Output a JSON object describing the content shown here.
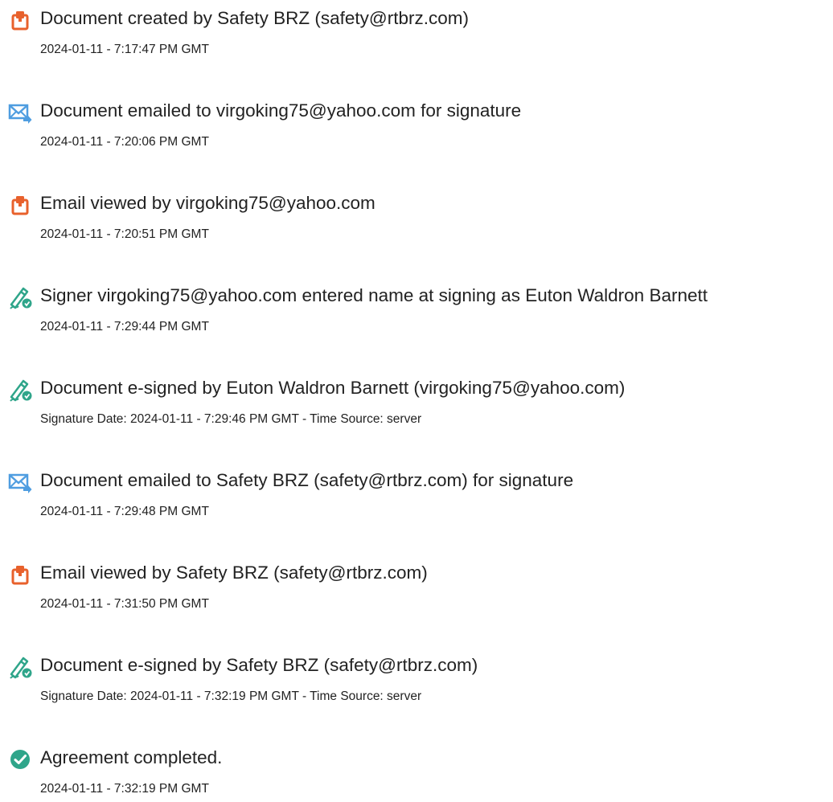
{
  "colors": {
    "document_icon": "#e8612c",
    "email_icon": "#4f9de0",
    "sign_icon": "#2fa58a",
    "complete_icon": "#2fa58a",
    "text": "#222222"
  },
  "events": [
    {
      "icon": "document-icon",
      "title": "Document created by Safety BRZ (safety@rtbrz.com)",
      "detail": "2024-01-11 - 7:17:47 PM GMT"
    },
    {
      "icon": "email-icon",
      "title": "Document emailed to virgoking75@yahoo.com for signature",
      "detail": "2024-01-11 - 7:20:06 PM GMT"
    },
    {
      "icon": "document-icon",
      "title": "Email viewed by virgoking75@yahoo.com",
      "detail": "2024-01-11 - 7:20:51 PM GMT"
    },
    {
      "icon": "signature-icon",
      "title": "Signer virgoking75@yahoo.com entered name at signing as Euton Waldron Barnett",
      "detail": "2024-01-11 - 7:29:44 PM GMT"
    },
    {
      "icon": "signature-icon",
      "title": "Document e-signed by Euton Waldron Barnett (virgoking75@yahoo.com)",
      "detail": "Signature Date: 2024-01-11 - 7:29:46 PM GMT - Time Source: server"
    },
    {
      "icon": "email-icon",
      "title": "Document emailed to Safety BRZ (safety@rtbrz.com) for signature",
      "detail": "2024-01-11 - 7:29:48 PM GMT"
    },
    {
      "icon": "document-icon",
      "title": "Email viewed by Safety BRZ (safety@rtbrz.com)",
      "detail": "2024-01-11 - 7:31:50 PM GMT"
    },
    {
      "icon": "signature-icon",
      "title": "Document e-signed by Safety BRZ (safety@rtbrz.com)",
      "detail": "Signature Date: 2024-01-11 - 7:32:19 PM GMT - Time Source: server"
    },
    {
      "icon": "check-circle-icon",
      "title": "Agreement completed.",
      "detail": "2024-01-11 - 7:32:19 PM GMT"
    }
  ]
}
